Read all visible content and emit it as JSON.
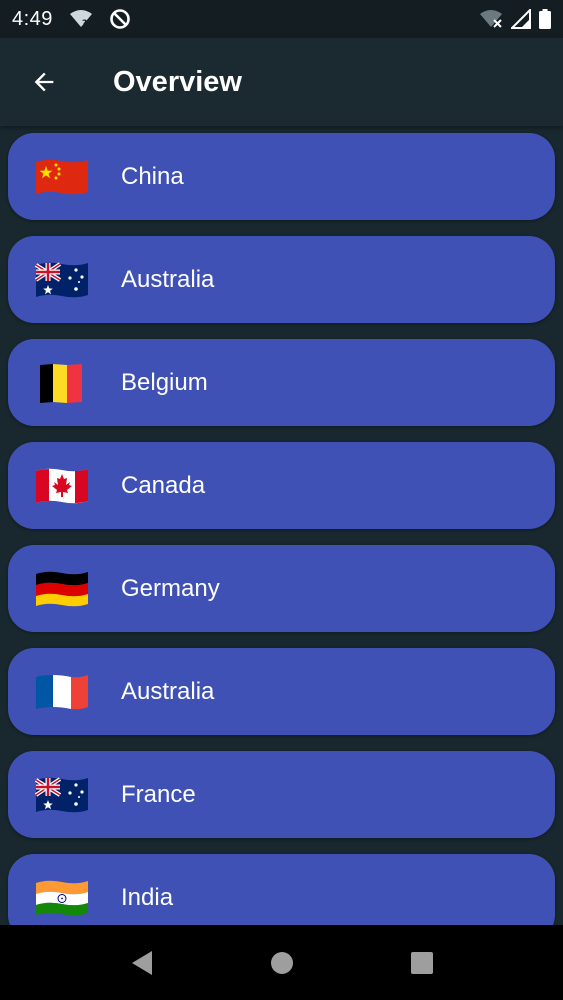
{
  "status_bar": {
    "time": "4:49",
    "icons": [
      "wifi-unknown-icon",
      "no-disturb-icon",
      "wifi-off-icon",
      "signal-icon",
      "battery-icon"
    ]
  },
  "app_bar": {
    "title": "Overview",
    "back_icon": "arrow-back-icon"
  },
  "colors": {
    "card": "#3f51b5",
    "background": "#18282e",
    "app_bar": "#1a2a30",
    "status_bar": "#141e22"
  },
  "countries": [
    {
      "name": "China",
      "flag": "cn"
    },
    {
      "name": "Australia",
      "flag": "au"
    },
    {
      "name": "Belgium",
      "flag": "be"
    },
    {
      "name": "Canada",
      "flag": "ca"
    },
    {
      "name": "Germany",
      "flag": "de"
    },
    {
      "name": "Australia",
      "flag": "fr"
    },
    {
      "name": "France",
      "flag": "au"
    },
    {
      "name": "India",
      "flag": "in"
    }
  ],
  "nav_bar": {
    "icons": [
      "back-triangle-icon",
      "home-circle-icon",
      "recents-square-icon"
    ]
  }
}
